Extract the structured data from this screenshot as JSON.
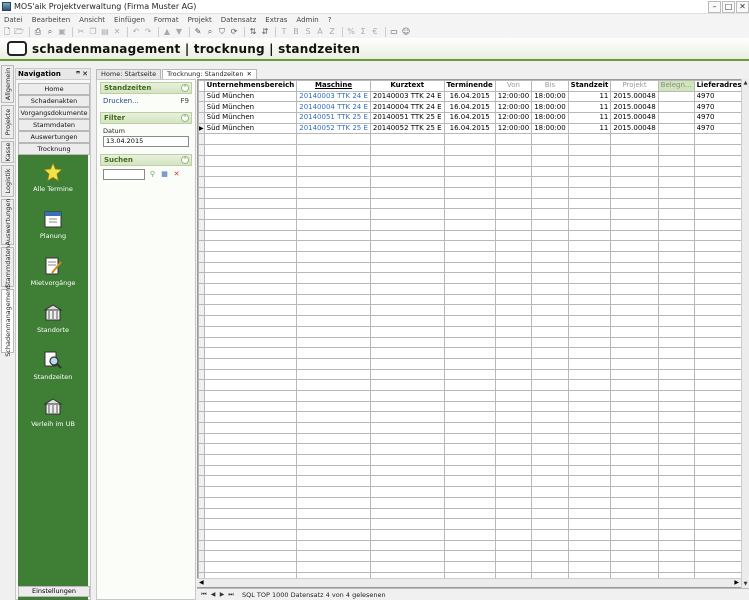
{
  "window": {
    "title": "MOS'aik Projektverwaltung (Firma Muster AG)",
    "buttons": [
      "–",
      "□",
      "✕"
    ]
  },
  "menu": [
    "Datei",
    "Bearbeiten",
    "Ansicht",
    "Einfügen",
    "Format",
    "Projekt",
    "Datensatz",
    "Extras",
    "Admin",
    "?"
  ],
  "header": {
    "title": "schadenmanagement | trocknung | standzeiten"
  },
  "vtabs": [
    "Allgemein",
    "Projekte",
    "Kasse",
    "Logistik",
    "Auswertungen",
    "Stammdaten",
    "Schadenmanagement"
  ],
  "nav": {
    "title": "Navigation",
    "pin": "ꟸ",
    "close": "✕",
    "items": [
      "Home",
      "Schadenakten",
      "Vorgangsdokumente",
      "Stammdaten",
      "Auswertungen",
      "Trocknung"
    ],
    "tiles": [
      "Alle Termine",
      "Planung",
      "Mietvorgänge",
      "Standorte",
      "Standzeiten",
      "Verleih im UB"
    ],
    "footer": "Einstellungen"
  },
  "doctabs": [
    {
      "label": "Home: Startseite"
    },
    {
      "label": "Trocknung: Standzeiten",
      "close": "✕"
    }
  ],
  "taskpane": {
    "standzeiten": {
      "title": "Standzeiten",
      "link": "Drucken...",
      "shortcut": "F9"
    },
    "filter": {
      "title": "Filter",
      "label": "Datum",
      "value": "13.04.2015"
    },
    "suchen": {
      "title": "Suchen"
    }
  },
  "grid": {
    "columns": [
      "Unternehmensbereich",
      "Maschine",
      "Kurztext",
      "Terminende",
      "Von",
      "Bis",
      "Standzeit",
      "Projekt",
      "Belegn...",
      "LieferadressePLZ"
    ],
    "rows": [
      [
        "Süd München",
        "20140003 TTK 24 E",
        "20140003 TTK 24 E",
        "16.04.2015",
        "12:00:00",
        "18:00:00",
        "11",
        "2015.00048",
        "",
        "4970"
      ],
      [
        "Süd München",
        "20140004 TTK 24 E",
        "20140004 TTK 24 E",
        "16.04.2015",
        "12:00:00",
        "18:00:00",
        "11",
        "2015.00048",
        "",
        "4970"
      ],
      [
        "Süd München",
        "20140051 TTK 25 E",
        "20140051 TTK 25 E",
        "16.04.2015",
        "12:00:00",
        "18:00:00",
        "11",
        "2015.00048",
        "",
        "4970"
      ],
      [
        "Süd München",
        "20140052 TTK 25 E",
        "20140052 TTK 25 E",
        "16.04.2015",
        "12:00:00",
        "18:00:00",
        "11",
        "2015.00048",
        "",
        "4970"
      ]
    ],
    "current_row_marker": "▶"
  },
  "status": {
    "text": "SQL TOP 1000 Datensatz 4 von 4 gelesenen"
  },
  "colors": {
    "accent_green": "#3f7f35",
    "link_blue": "#2f6fbf",
    "header_line": "#6a9a3a"
  }
}
